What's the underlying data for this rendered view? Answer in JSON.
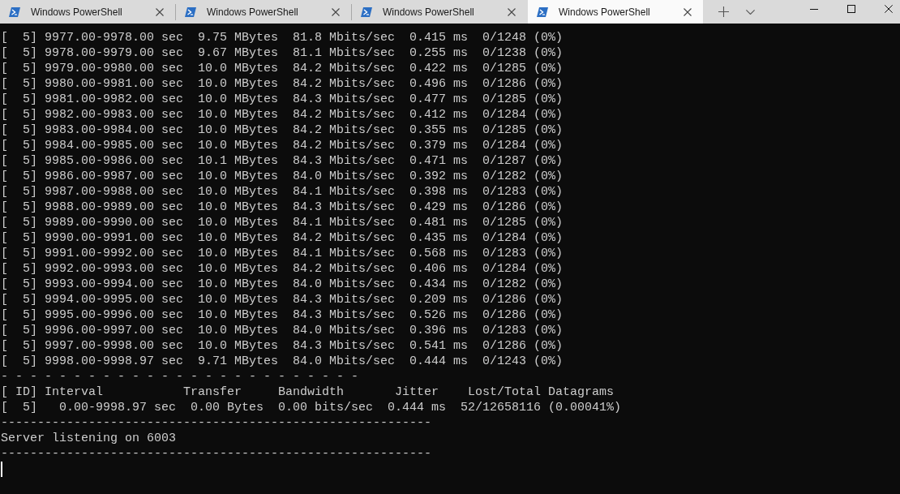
{
  "tabs": [
    {
      "title": "Windows PowerShell",
      "selected": false
    },
    {
      "title": "Windows PowerShell",
      "selected": false
    },
    {
      "title": "Windows PowerShell",
      "selected": false
    },
    {
      "title": "Windows PowerShell",
      "selected": true
    }
  ],
  "terminal": {
    "lines": [
      "[  5] 9977.00-9978.00 sec  9.75 MBytes  81.8 Mbits/sec  0.415 ms  0/1248 (0%)",
      "[  5] 9978.00-9979.00 sec  9.67 MBytes  81.1 Mbits/sec  0.255 ms  0/1238 (0%)",
      "[  5] 9979.00-9980.00 sec  10.0 MBytes  84.2 Mbits/sec  0.422 ms  0/1285 (0%)",
      "[  5] 9980.00-9981.00 sec  10.0 MBytes  84.2 Mbits/sec  0.496 ms  0/1286 (0%)",
      "[  5] 9981.00-9982.00 sec  10.0 MBytes  84.3 Mbits/sec  0.477 ms  0/1285 (0%)",
      "[  5] 9982.00-9983.00 sec  10.0 MBytes  84.2 Mbits/sec  0.412 ms  0/1284 (0%)",
      "[  5] 9983.00-9984.00 sec  10.0 MBytes  84.2 Mbits/sec  0.355 ms  0/1285 (0%)",
      "[  5] 9984.00-9985.00 sec  10.0 MBytes  84.2 Mbits/sec  0.379 ms  0/1284 (0%)",
      "[  5] 9985.00-9986.00 sec  10.1 MBytes  84.3 Mbits/sec  0.471 ms  0/1287 (0%)",
      "[  5] 9986.00-9987.00 sec  10.0 MBytes  84.0 Mbits/sec  0.392 ms  0/1282 (0%)",
      "[  5] 9987.00-9988.00 sec  10.0 MBytes  84.1 Mbits/sec  0.398 ms  0/1283 (0%)",
      "[  5] 9988.00-9989.00 sec  10.0 MBytes  84.3 Mbits/sec  0.429 ms  0/1286 (0%)",
      "[  5] 9989.00-9990.00 sec  10.0 MBytes  84.1 Mbits/sec  0.481 ms  0/1285 (0%)",
      "[  5] 9990.00-9991.00 sec  10.0 MBytes  84.2 Mbits/sec  0.435 ms  0/1284 (0%)",
      "[  5] 9991.00-9992.00 sec  10.0 MBytes  84.1 Mbits/sec  0.568 ms  0/1283 (0%)",
      "[  5] 9992.00-9993.00 sec  10.0 MBytes  84.2 Mbits/sec  0.406 ms  0/1284 (0%)",
      "[  5] 9993.00-9994.00 sec  10.0 MBytes  84.0 Mbits/sec  0.434 ms  0/1282 (0%)",
      "[  5] 9994.00-9995.00 sec  10.0 MBytes  84.3 Mbits/sec  0.209 ms  0/1286 (0%)",
      "[  5] 9995.00-9996.00 sec  10.0 MBytes  84.3 Mbits/sec  0.526 ms  0/1286 (0%)",
      "[  5] 9996.00-9997.00 sec  10.0 MBytes  84.0 Mbits/sec  0.396 ms  0/1283 (0%)",
      "[  5] 9997.00-9998.00 sec  10.0 MBytes  84.3 Mbits/sec  0.541 ms  0/1286 (0%)",
      "[  5] 9998.00-9998.97 sec  9.71 MBytes  84.0 Mbits/sec  0.444 ms  0/1243 (0%)",
      "- - - - - - - - - - - - - - - - - - - - - - - - -",
      "[ ID] Interval           Transfer     Bandwidth       Jitter    Lost/Total Datagrams",
      "[  5]   0.00-9998.97 sec  0.00 Bytes  0.00 bits/sec  0.444 ms  52/12658116 (0.00041%)",
      "-----------------------------------------------------------",
      "Server listening on 6003",
      "-----------------------------------------------------------"
    ],
    "cursor_visible": true
  }
}
